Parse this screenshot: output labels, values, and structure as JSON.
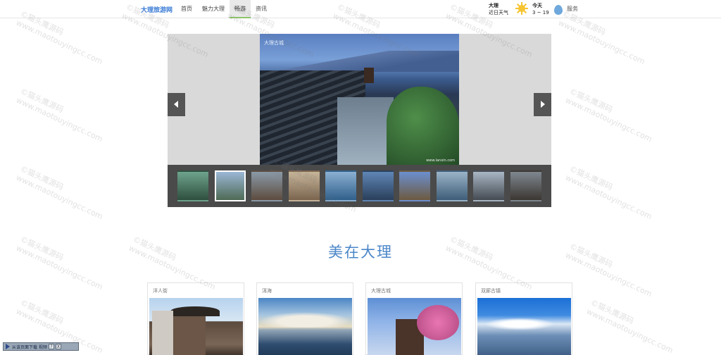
{
  "nav": {
    "brand": "大理旅游网",
    "links": [
      {
        "label": "首页",
        "active": false
      },
      {
        "label": "魅力大理",
        "active": false
      },
      {
        "label": "畅游",
        "active": true
      },
      {
        "label": "资讯",
        "active": false
      }
    ],
    "weather": {
      "city": "大理",
      "city_sub": "近日天气",
      "today_label": "今天",
      "today_temp": "3 ~ 19",
      "icon": "sun-icon"
    },
    "service_label": "服务"
  },
  "carousel": {
    "main_photo_caption": "大理古城",
    "main_photo_credit": "www.lanxin.com",
    "selected_index": 1,
    "thumbnails": [
      {
        "color_top": "#6ea38d",
        "color_bottom": "#2e4f3d"
      },
      {
        "color_top": "#9bb7d6",
        "color_bottom": "#4e6a54"
      },
      {
        "color_top": "#8a9aa8",
        "color_bottom": "#5d4b3e"
      },
      {
        "color_top": "#c7b59a",
        "color_bottom": "#7a644e"
      },
      {
        "color_top": "#8bb0d2",
        "color_bottom": "#2f5f8a"
      },
      {
        "color_top": "#5f86b6",
        "color_bottom": "#2a3f5a"
      },
      {
        "color_top": "#6b8fcf",
        "color_bottom": "#6d5a3f"
      },
      {
        "color_top": "#9ab3c8",
        "color_bottom": "#3e5d78"
      },
      {
        "color_top": "#a9b6c4",
        "color_bottom": "#444a52"
      },
      {
        "color_top": "#7f8790",
        "color_bottom": "#3b3631"
      }
    ]
  },
  "section": {
    "title": "美在大理",
    "cards": [
      {
        "label": "洋人街"
      },
      {
        "label": "洱海"
      },
      {
        "label": "大理古城"
      },
      {
        "label": "双廊古镇"
      }
    ]
  },
  "watermark": {
    "line1": "©猫头鹰源码",
    "line2": "www.maotouyingcc.com"
  },
  "download_bar": {
    "label": "从该页面下载 视频",
    "help": "?",
    "close": "X"
  },
  "colors": {
    "accent": "#3a7bd5",
    "title": "#4a86c8",
    "nav_active_border": "#8dc46b"
  }
}
